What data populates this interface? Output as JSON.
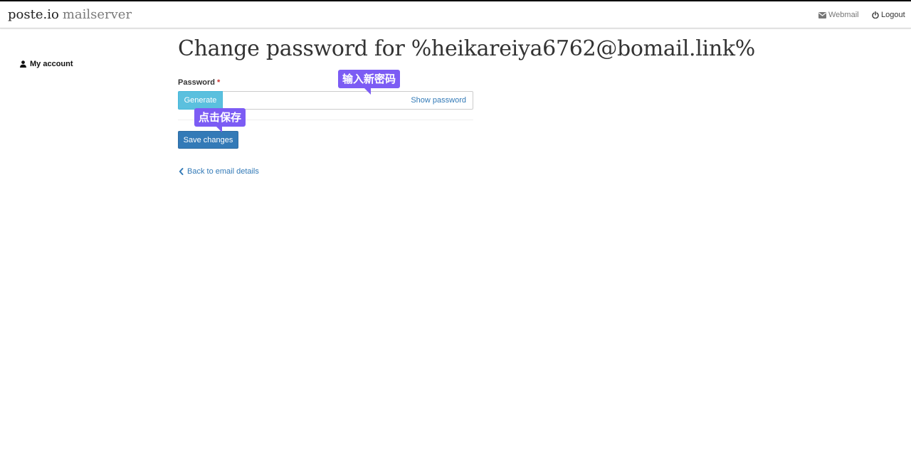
{
  "brand": {
    "name": "poste.io",
    "suffix": "mailserver"
  },
  "nav": {
    "webmail_label": "Webmail",
    "logout_label": "Logout"
  },
  "sidebar": {
    "items": [
      {
        "label": "My account",
        "icon": "user-icon"
      }
    ]
  },
  "main": {
    "title": "Change password for %heikareiya6762@bomail.link%",
    "password_label": "Password",
    "required_mark": "*",
    "generate_label": "Generate",
    "password_value": "",
    "show_password_label": "Show password",
    "save_label": "Save changes",
    "back_label": "Back to email details"
  },
  "annotations": {
    "enter_password": "输入新密码",
    "click_save": "点击保存"
  },
  "colors": {
    "accent": "#337ab7",
    "info": "#5bc0de",
    "annotation": "#7c5cf4",
    "required": "#c9302c"
  }
}
